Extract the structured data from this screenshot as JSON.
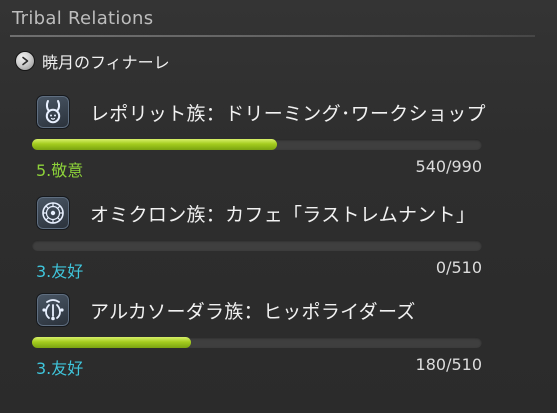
{
  "window": {
    "title": "Tribal Relations"
  },
  "section": {
    "label": "暁月のフィナーレ",
    "toggle_icon": "chevron-right-icon"
  },
  "colors": {
    "bar_fill": "#a4cc1e",
    "rank_respected": "#8dd23a",
    "rank_friendly": "#3fc6dc"
  },
  "tribes": [
    {
      "name": "レポリット族：ドリーミング･ワークショップ",
      "icon": "rabbit-icon",
      "rank": "5.敬意",
      "rank_color": "#8dd23a",
      "progress_text": "540/990",
      "progress_fraction": 0.545
    },
    {
      "name": "オミクロン族：カフェ「ラストレムナント」",
      "icon": "flower-gear-icon",
      "rank": "3.友好",
      "rank_color": "#3fc6dc",
      "progress_text": "0/510",
      "progress_fraction": 0
    },
    {
      "name": "アルカソーダラ族：ヒッポライダーズ",
      "icon": "tentacle-icon",
      "rank": "3.友好",
      "rank_color": "#3fc6dc",
      "progress_text": "180/510",
      "progress_fraction": 0.353
    }
  ]
}
